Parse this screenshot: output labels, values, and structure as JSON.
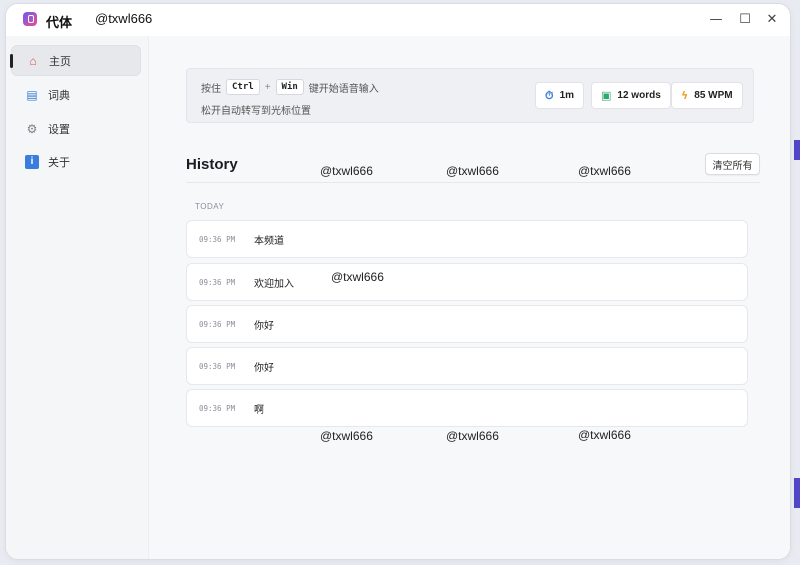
{
  "app": {
    "title": "代体",
    "user": "@txwl666"
  },
  "window_controls": {
    "minimize": "—",
    "maximize": "☐",
    "close": "✕"
  },
  "sidebar": {
    "items": [
      {
        "label": "主页",
        "icon": "home-icon"
      },
      {
        "label": "词典",
        "icon": "dictionary-icon"
      },
      {
        "label": "设置",
        "icon": "gear-icon"
      },
      {
        "label": "关于",
        "icon": "info-icon"
      }
    ],
    "active": "主页"
  },
  "hint": {
    "press": "按住",
    "key1": "Ctrl",
    "plus": "+",
    "key2": "Win",
    "action": "键开始语音输入",
    "line2": "松开自动转写到光标位置"
  },
  "stats": {
    "time": "1m",
    "words": "12 words",
    "wpm": "85 WPM"
  },
  "history": {
    "title": "History",
    "clear_label": "清空所有",
    "group_label": "TODAY",
    "entries": [
      {
        "time": "09:36 PM",
        "text": "本频道"
      },
      {
        "time": "09:36 PM",
        "text": "欢迎加入"
      },
      {
        "time": "09:36 PM",
        "text": "你好"
      },
      {
        "time": "09:36 PM",
        "text": "你好"
      },
      {
        "time": "09:36 PM",
        "text": "啊"
      }
    ]
  },
  "watermark": "@txwl666",
  "colors": {
    "accent": "#5146c7",
    "logo_start": "#6c5ce7",
    "logo_end": "#e74c9c"
  }
}
